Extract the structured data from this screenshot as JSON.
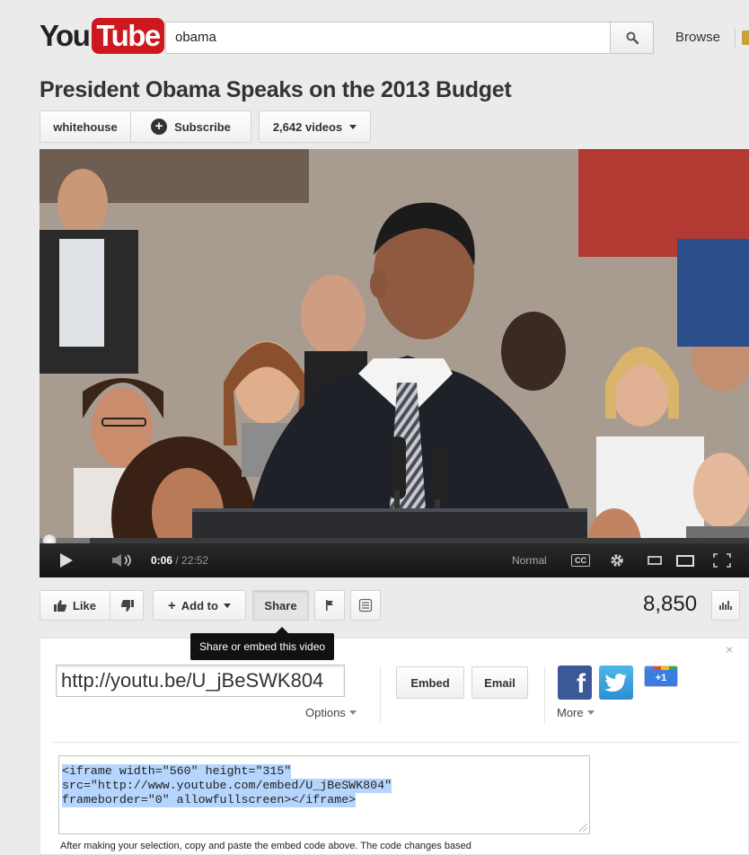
{
  "header": {
    "logo_you": "You",
    "logo_tube": "Tube",
    "search_value": "obama",
    "browse_label": "Browse"
  },
  "video": {
    "title": "President Obama Speaks on the 2013 Budget",
    "channel_name": "whitehouse",
    "subscribe_label": "Subscribe",
    "videos_count_label": "2,642 videos",
    "current_time": "0:06",
    "total_time": "/ 22:52",
    "quality_label": "Normal",
    "cc_label": "CC",
    "progress_fraction": 0.0044,
    "view_count": "8,850"
  },
  "actions": {
    "like_label": "Like",
    "add_to_label": "Add to",
    "share_label": "Share",
    "tooltip": "Share or embed this video"
  },
  "share_panel": {
    "close_label": "×",
    "url_value": "http://youtu.be/U_jBeSWK804",
    "options_label": "Options",
    "embed_label": "Embed",
    "email_label": "Email",
    "plusone_label": "+1",
    "more_label": "More",
    "embed_code_lines": [
      "<iframe width=\"560\" height=\"315\"",
      "src=\"http://www.youtube.com/embed/U_jBeSWK804\"",
      "frameborder=\"0\" allowfullscreen></iframe>"
    ],
    "note": "After making your selection, copy and paste the embed code above. The code changes based"
  },
  "colors": {
    "brand_red": "#cc181e",
    "facebook": "#3b5998",
    "twitter": "#2b8fd0",
    "selection": "#b5d5fd"
  },
  "icons": [
    "search-icon",
    "plus-circle-icon",
    "chevron-down-icon",
    "play-icon",
    "volume-icon",
    "cc-icon",
    "gear-icon",
    "small-player-icon",
    "large-player-icon",
    "fullscreen-icon",
    "thumbs-up-icon",
    "thumbs-down-icon",
    "flag-icon",
    "transcript-icon",
    "stats-icon",
    "facebook-icon",
    "twitter-icon",
    "google-plus-one-icon",
    "close-icon"
  ]
}
